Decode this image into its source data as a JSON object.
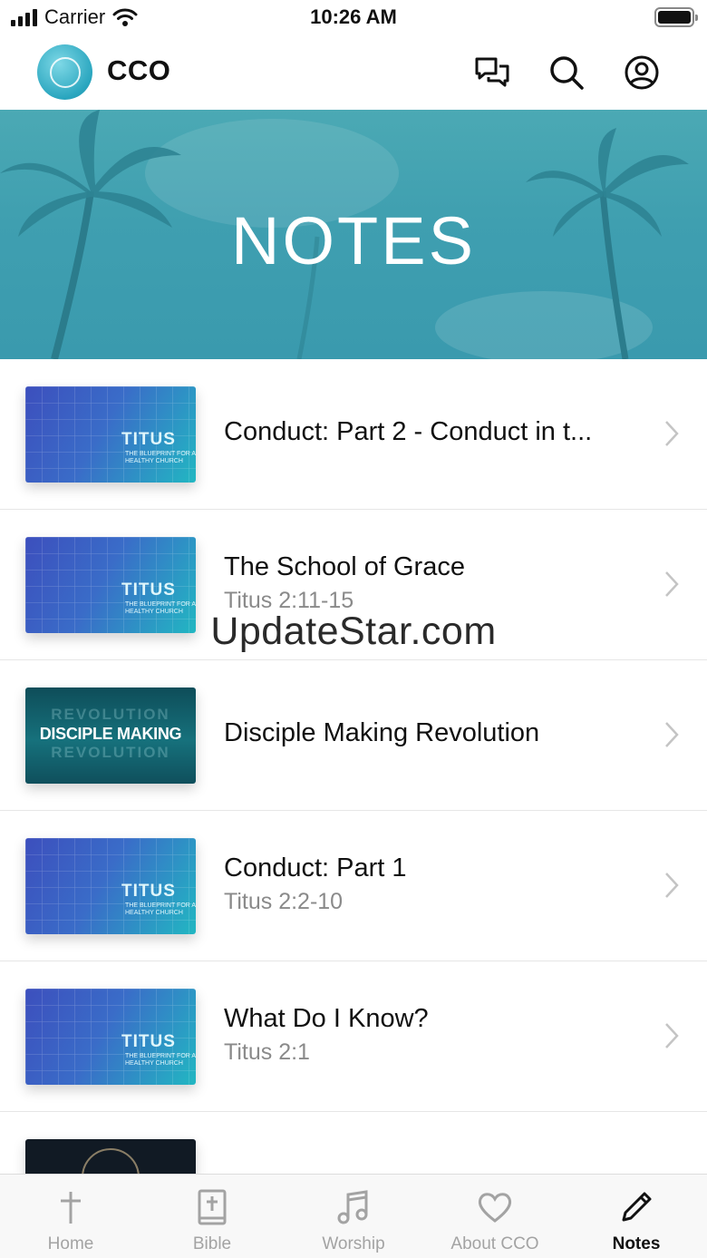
{
  "status_bar": {
    "carrier": "Carrier",
    "time": "10:26 AM",
    "battery_level": 1.0
  },
  "header": {
    "app_name": "CCO",
    "icons": [
      "chat-icon",
      "search-icon",
      "account-icon"
    ]
  },
  "banner": {
    "title": "NOTES"
  },
  "notes": [
    {
      "title": "Conduct: Part 2 - Conduct in t...",
      "subtitle": "",
      "thumbnail": "titus"
    },
    {
      "title": "The School of Grace",
      "subtitle": "Titus 2:11-15",
      "thumbnail": "titus"
    },
    {
      "title": "Disciple Making Revolution",
      "subtitle": "",
      "thumbnail": "disciple-making"
    },
    {
      "title": "Conduct: Part 1",
      "subtitle": "Titus 2:2-10",
      "thumbnail": "titus"
    },
    {
      "title": "What Do I Know?",
      "subtitle": "Titus 2:1",
      "thumbnail": "titus"
    },
    {
      "title": "",
      "subtitle": "",
      "thumbnail": "dark"
    }
  ],
  "thumb_text": {
    "titus": "TITUS",
    "titus_tag": "THE BLUEPRINT FOR A HEALTHY CHURCH",
    "disciple_main": "DISCIPLE MAKING",
    "revolution": "REVOLUTION"
  },
  "watermark": "UpdateStar.com",
  "tabs": [
    {
      "label": "Home",
      "icon": "cross-icon",
      "active": false
    },
    {
      "label": "Bible",
      "icon": "bible-icon",
      "active": false
    },
    {
      "label": "Worship",
      "icon": "music-note-icon",
      "active": false
    },
    {
      "label": "About CCO",
      "icon": "heart-icon",
      "active": false
    },
    {
      "label": "Notes",
      "icon": "pencil-icon",
      "active": true
    }
  ],
  "colors": {
    "banner": "#3f9fb0",
    "tab_active": "#111111",
    "tab_inactive": "#a3a3a3",
    "subtitle": "#8a8a8a"
  }
}
